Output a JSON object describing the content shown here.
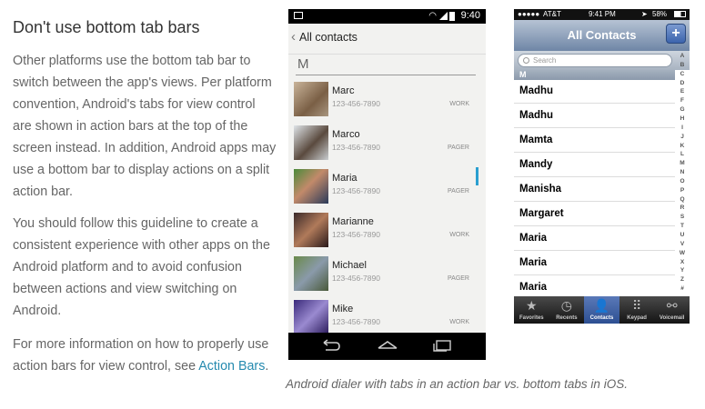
{
  "article": {
    "heading": "Don't use bottom tab bars",
    "p1": "Other platforms use the bottom tab bar to switch between the app's views. Per platform convention, Android's tabs for view control are shown in action bars at the top of the screen instead. In addition, Android apps may use a bottom bar to display actions on a split action bar.",
    "p2": "You should follow this guideline to create a consistent experience with other apps on the Android platform and to avoid confusion between actions and view switching on Android.",
    "p3_prefix": "For more information on how to properly use action bars for view control, see ",
    "p3_link": "Action Bars",
    "p3_suffix": "."
  },
  "caption": "Android dialer with tabs in an action bar vs. bottom tabs in iOS.",
  "android": {
    "status_time": "9:40",
    "action_title": "All contacts",
    "section": "M",
    "contacts": [
      {
        "name": "Marc",
        "phone": "123-456-7890",
        "type": "WORK"
      },
      {
        "name": "Marco",
        "phone": "123-456-7890",
        "type": "PAGER"
      },
      {
        "name": "Maria",
        "phone": "123-456-7890",
        "type": "PAGER"
      },
      {
        "name": "Marianne",
        "phone": "123-456-7890",
        "type": "WORK"
      },
      {
        "name": "Michael",
        "phone": "123-456-7890",
        "type": "PAGER"
      },
      {
        "name": "Mike",
        "phone": "123-456-7890",
        "type": "WORK"
      }
    ]
  },
  "ios": {
    "carrier": "AT&T",
    "time": "9:41 PM",
    "battery": "58%",
    "title": "All Contacts",
    "add": "+",
    "search_placeholder": "Search",
    "section": "M",
    "contacts": [
      "Madhu",
      "Madhu",
      "Mamta",
      "Mandy",
      "Manisha",
      "Margaret",
      "Maria",
      "Maria",
      "Maria"
    ],
    "index": [
      "A",
      "B",
      "C",
      "D",
      "E",
      "F",
      "G",
      "H",
      "I",
      "J",
      "K",
      "L",
      "M",
      "N",
      "O",
      "P",
      "Q",
      "R",
      "S",
      "T",
      "U",
      "V",
      "W",
      "X",
      "Y",
      "Z",
      "#"
    ],
    "tabs": [
      {
        "label": "Favorites",
        "icon": "★"
      },
      {
        "label": "Recents",
        "icon": "◷"
      },
      {
        "label": "Contacts",
        "icon": "👤"
      },
      {
        "label": "Keypad",
        "icon": "⠿"
      },
      {
        "label": "Voicemail",
        "icon": "⚯"
      }
    ]
  }
}
